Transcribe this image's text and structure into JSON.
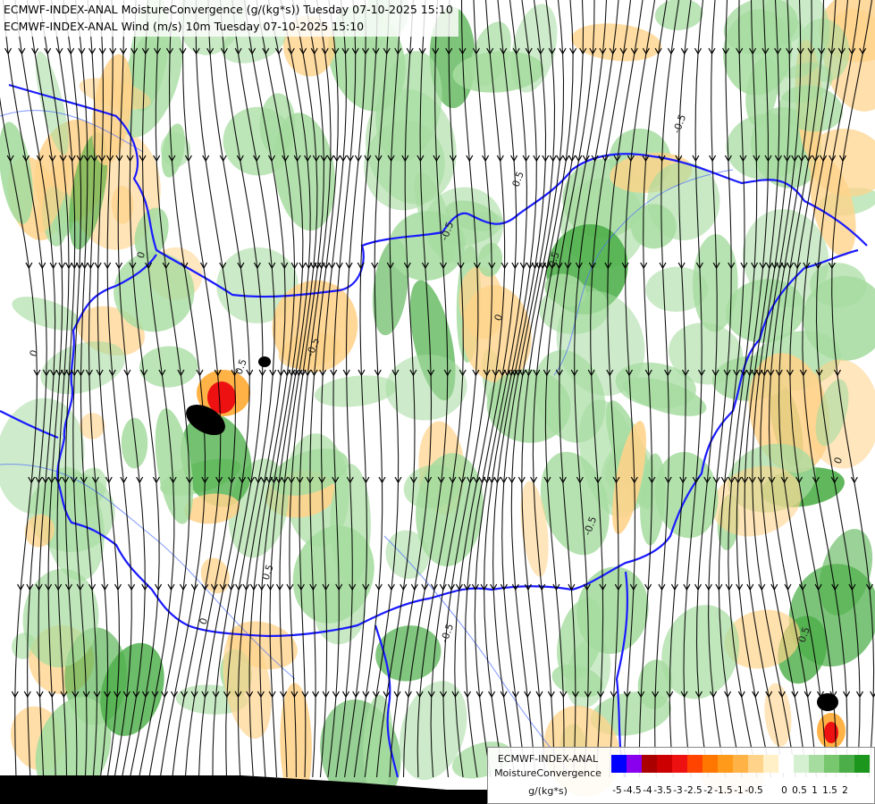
{
  "header": {
    "line1": "ECMWF-INDEX-ANAL MoistureConvergence (g/(kg*s)) Tuesday 07-10-2025 15:10",
    "line2": "ECMWF-INDEX-ANAL Wind (m/s) 10m Tuesday 07-10-2025 15:10"
  },
  "contour_labels": [
    "0",
    "-0.5",
    "0.5"
  ],
  "legend": {
    "model": "ECMWF-INDEX-ANAL",
    "parameter": "MoistureConvergence",
    "unit": "g/(kg*s)",
    "colors": [
      "#0000ff",
      "#8800ee",
      "#aa0000",
      "#cc0000",
      "#ee1111",
      "#ff4400",
      "#ff7700",
      "#ff9a1a",
      "#ffb347",
      "#ffd38a",
      "#fff0c8",
      "#ffffff",
      "#d5f0d0",
      "#a6dca0",
      "#78c66e",
      "#4cae48",
      "#1d961d"
    ],
    "tick_labels": [
      "-5",
      "-4.5",
      "-4",
      "-3.5",
      "-3",
      "-2.5",
      "-2",
      "-1.5",
      "-1",
      "-0.5",
      "0",
      "0.5",
      "1",
      "1.5",
      "2"
    ],
    "tick_slots": [
      0,
      1,
      2,
      3,
      4,
      5,
      6,
      7,
      8,
      9,
      11,
      12,
      13,
      14,
      15
    ]
  },
  "map_colors": {
    "border": "#1a1aff",
    "streamline": "#000000",
    "positive": "#a6dca0",
    "strong_positive": "#4cae48",
    "negative": "#ffd38a",
    "strong_negative": "#ee1111"
  }
}
